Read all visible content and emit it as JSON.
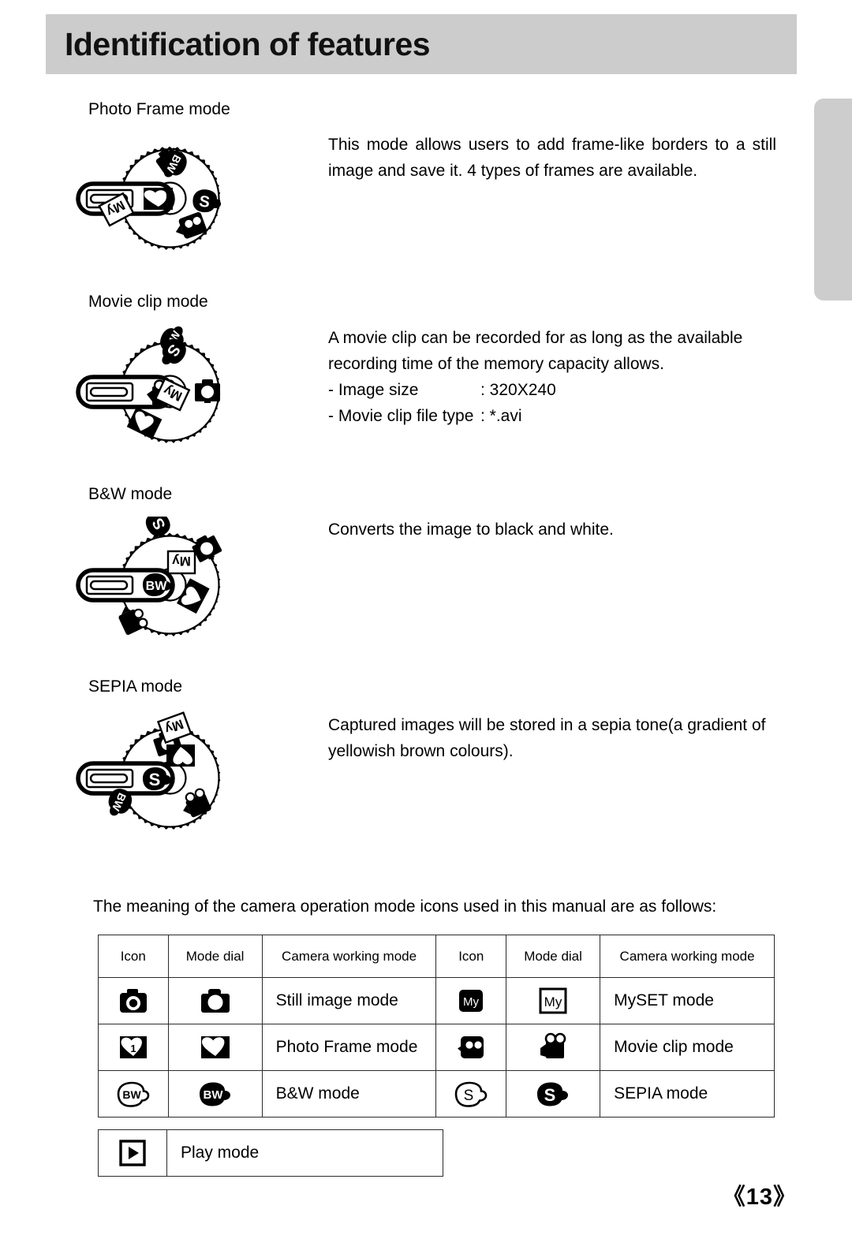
{
  "page": {
    "title": "Identification of features",
    "page_number": "《13》"
  },
  "sections": [
    {
      "label": "Photo Frame mode",
      "dial_selected": "photo-frame",
      "paragraphs": [
        "This mode allows users to add frame-like borders to a still image and save it. 4 types of frames are available."
      ],
      "specs": []
    },
    {
      "label": "Movie clip mode",
      "dial_selected": "movie-clip",
      "paragraphs": [
        "A movie clip can be recorded for as long as the available recording time of the memory capacity allows."
      ],
      "specs": [
        {
          "name": "- Image size",
          "value": ": 320X240"
        },
        {
          "name": "- Movie clip file type",
          "value": ": *.avi"
        }
      ]
    },
    {
      "label": "B&W mode",
      "dial_selected": "bw",
      "paragraphs": [
        "Converts the image to black and white."
      ],
      "specs": []
    },
    {
      "label": "SEPIA mode",
      "dial_selected": "sepia",
      "paragraphs": [
        "Captured images will be stored in a sepia tone(a gradient of yellowish brown colours)."
      ],
      "specs": []
    }
  ],
  "table": {
    "intro": "The meaning of the camera operation mode icons used in this manual are as follows:",
    "headers": [
      "Icon",
      "Mode dial",
      "Camera working mode",
      "Icon",
      "Mode dial",
      "Camera working mode"
    ],
    "rows": [
      {
        "left": {
          "icon": "still-image-icon",
          "dial": "still-image-dial",
          "label": "Still image mode"
        },
        "right": {
          "icon": "myset-icon",
          "dial": "myset-dial",
          "label": "MySET mode"
        }
      },
      {
        "left": {
          "icon": "photo-frame-icon",
          "dial": "photo-frame-dial",
          "label": "Photo Frame mode"
        },
        "right": {
          "icon": "movie-clip-icon",
          "dial": "movie-clip-dial",
          "label": "Movie clip mode"
        }
      },
      {
        "left": {
          "icon": "bw-icon",
          "dial": "bw-dial",
          "label": "B&W mode"
        },
        "right": {
          "icon": "sepia-icon",
          "dial": "sepia-dial",
          "label": "SEPIA mode"
        }
      }
    ],
    "play_row": {
      "icon": "play-icon",
      "label": "Play mode"
    }
  },
  "colors": {
    "header_band": "#cccccc",
    "edge_tab": "#cdcdcd",
    "ink": "#000000",
    "table_border": "#2b2b2b"
  }
}
